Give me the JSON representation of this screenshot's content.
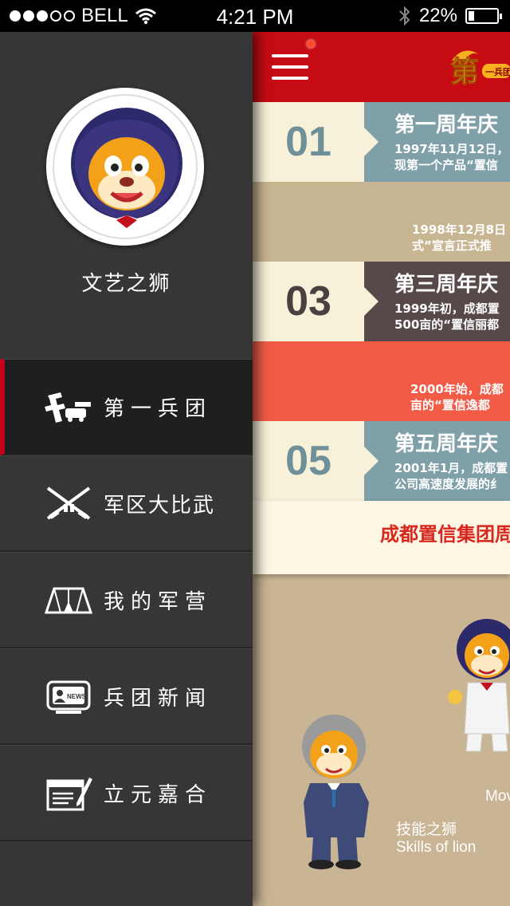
{
  "status_bar": {
    "carrier": "BELL",
    "time": "4:21 PM",
    "battery": "22%",
    "battery_level": 0.22,
    "signal_dots": [
      true,
      true,
      true,
      false,
      false
    ],
    "icons": [
      "wifi-icon",
      "bluetooth-icon",
      "battery-icon"
    ]
  },
  "sidebar": {
    "username": "文艺之狮",
    "avatar_icon": "lion-mascot-avatar",
    "items": [
      {
        "label": "第一兵团",
        "icon": "first-legion-icon",
        "active": true
      },
      {
        "label": "军区大比武",
        "icon": "crossed-rifles-icon",
        "active": false
      },
      {
        "label": "我的军营",
        "icon": "tent-icon",
        "active": false
      },
      {
        "label": "兵团新闻",
        "icon": "news-icon",
        "active": false
      },
      {
        "label": "立元嘉合",
        "icon": "document-pen-icon",
        "active": false
      }
    ]
  },
  "header": {
    "menu_icon": "hamburger-menu-icon",
    "logo_text": "第一兵团",
    "colors": {
      "bar": "#c60b12"
    }
  },
  "timeline": [
    {
      "num": "01",
      "title": "第一周年庆",
      "desc": [
        "1997年11月12日，",
        "现第一个产品“置信"
      ],
      "num_color": "#6f8f99",
      "panel_color": "#7fa0a8",
      "num_bg": "#f6f1d8"
    },
    {
      "num": "",
      "title": "",
      "desc": [
        "1998年12月8日",
        "式”宣言正式推"
      ],
      "num_color": "#6f8f99",
      "panel_color": "#c8b592",
      "num_bg": "#c8b592"
    },
    {
      "num": "03",
      "title": "第三周年庆",
      "desc": [
        "1999年初，成都置",
        "500亩的“置信丽都"
      ],
      "num_color": "#4c3f40",
      "panel_color": "#574849",
      "num_bg": "#f6f1d8"
    },
    {
      "num": "",
      "title": "",
      "desc": [
        "2000年始，成都",
        "亩的“置信逸都"
      ],
      "num_color": "#4c3f40",
      "panel_color": "#f25c47",
      "num_bg": "#f25c47"
    },
    {
      "num": "05",
      "title": "第五周年庆",
      "desc": [
        "2001年1月，成都置",
        "公司高速度发展的纟"
      ],
      "num_color": "#6f8f99",
      "panel_color": "#7fa0a8",
      "num_bg": "#f6f1d8"
    }
  ],
  "banner": {
    "text": "成都置信集团周"
  },
  "mascots": {
    "lion_left_caption_cn": "技能之狮",
    "lion_left_caption_en": "Skills of lion",
    "lion_right_caption": "Mov"
  }
}
